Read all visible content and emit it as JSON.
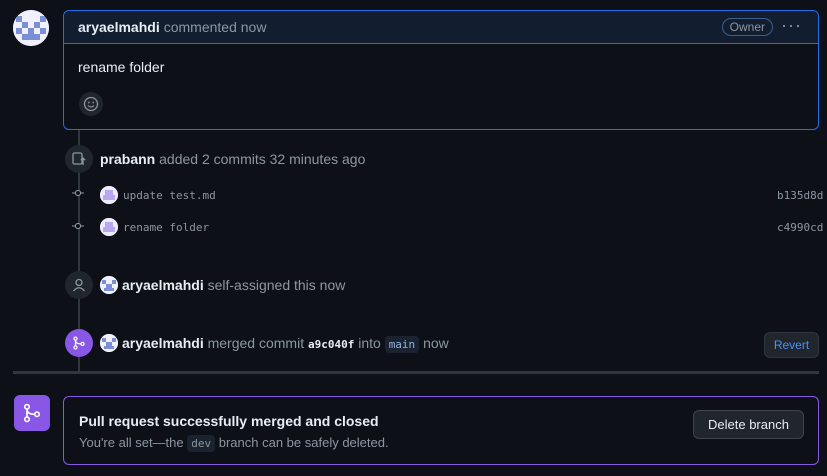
{
  "comment": {
    "author": "aryaelmahdi",
    "meta": "commented now",
    "badge": "Owner",
    "more": "···",
    "body": "rename folder"
  },
  "timeline": {
    "commits_event": {
      "author": "prabann",
      "text": "added 2 commits 32 minutes ago"
    },
    "commits": [
      {
        "message": "update test.md",
        "sha": "b135d8d"
      },
      {
        "message": "rename folder",
        "sha": "c4990cd"
      }
    ],
    "assign_event": {
      "author": "aryaelmahdi",
      "text": "self-assigned this now"
    },
    "merge_event": {
      "author": "aryaelmahdi",
      "pre": "merged commit",
      "commit": "a9c040f",
      "mid": "into",
      "branch": "main",
      "post": "now",
      "revert_label": "Revert"
    }
  },
  "merge_status": {
    "title": "Pull request successfully merged and closed",
    "sub_pre": "You're all set—the",
    "branch": "dev",
    "sub_post": "branch can be safely deleted.",
    "delete_label": "Delete branch"
  },
  "colors": {
    "accent_blue": "#1f6feb",
    "merged_purple": "#8957e5",
    "link_blue": "#4493f8"
  }
}
